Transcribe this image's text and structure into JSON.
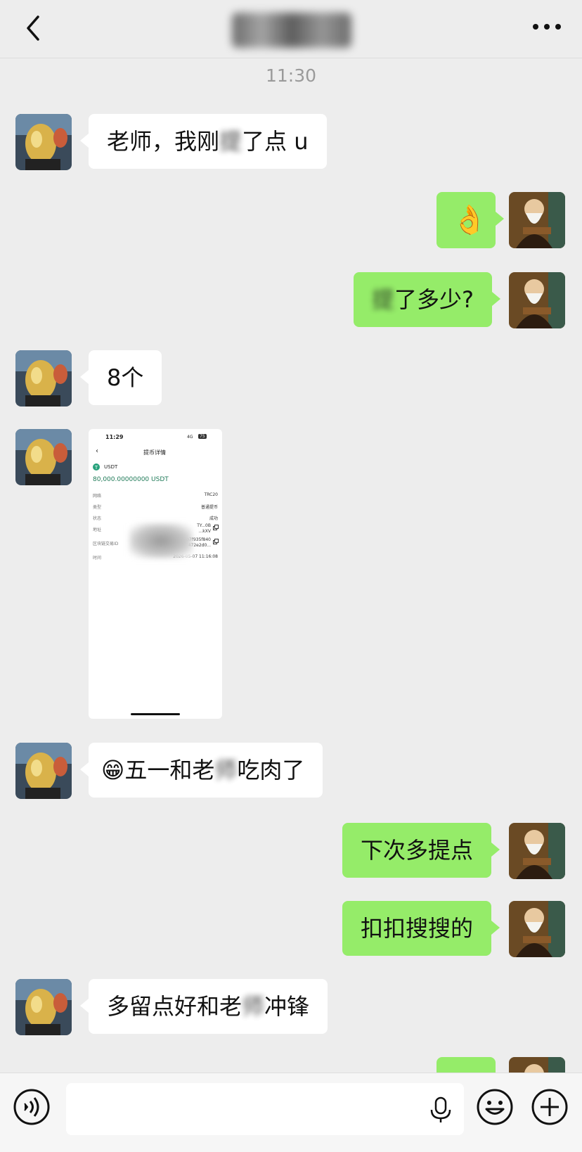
{
  "header": {
    "back_icon": "chevron-left-icon",
    "more_icon": "more-dots-icon",
    "title_state": "blurred"
  },
  "timestamp": "11:30",
  "messages": [
    {
      "side": "in",
      "text_parts": [
        "老师，我刚",
        "提",
        "了点 u"
      ]
    },
    {
      "side": "out",
      "emoji": "👌"
    },
    {
      "side": "out",
      "text_parts": [
        "",
        "提",
        "了多少?"
      ]
    },
    {
      "side": "in",
      "text": "8个"
    },
    {
      "side": "in",
      "type": "image",
      "image": {
        "status_time": "11:29",
        "status_net": "4G",
        "battery": "75",
        "screen_title": "提币详情",
        "coin": "USDT",
        "amount": "80,000.00000000 USDT",
        "rows": [
          {
            "label": "网络",
            "value": "TRC20"
          },
          {
            "label": "类型",
            "value": "普通提币"
          },
          {
            "label": "状态",
            "value": "成功"
          },
          {
            "label": "地址",
            "value": "TY...0B\n...kXV"
          },
          {
            "label": "区块链交易ID",
            "value": "...b7f935f840\n...472e2d0..."
          },
          {
            "label": "时间",
            "value": "2026-05-07 11:16:08"
          }
        ]
      }
    },
    {
      "side": "in",
      "text_parts": [
        "😁五一和老",
        "师",
        "吃肉了"
      ]
    },
    {
      "side": "out",
      "text": "下次多提点"
    },
    {
      "side": "out",
      "text": "扣扣搜搜的"
    },
    {
      "side": "in",
      "text_parts": [
        "多留点好和老",
        "师",
        "冲锋"
      ]
    }
  ],
  "colors": {
    "outgoing_bubble": "#95ec69",
    "incoming_bubble": "#ffffff",
    "background": "#ededed",
    "usdt": "#26a17b"
  },
  "input_bar": {
    "voice_icon": "voice-toggle-icon",
    "mic_icon": "mic-icon",
    "emoji_icon": "emoji-icon",
    "plus_icon": "plus-icon"
  }
}
